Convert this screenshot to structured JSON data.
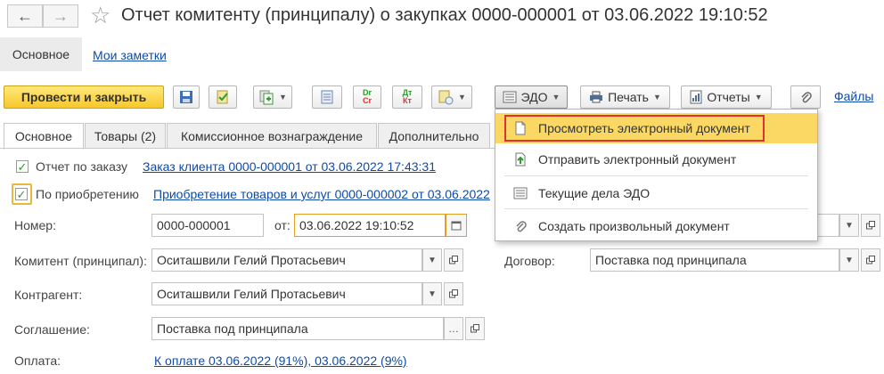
{
  "window": {
    "title": "Отчет комитенту (принципалу) о закупках 0000-000001 от 03.06.2022 19:10:52",
    "back_glyph": "←",
    "forward_glyph": "→",
    "star_glyph": "☆"
  },
  "subtabs": {
    "main": "Основное",
    "notes": "Мои заметки"
  },
  "toolbar": {
    "post_close": "Провести и закрыть",
    "edo": "ЭДО",
    "print": "Печать",
    "reports": "Отчеты",
    "files": "Файлы",
    "dtkt": {
      "top": "Дт",
      "bottom": "Кт"
    },
    "drcr": {
      "top": "Dr",
      "bottom": "Cr"
    }
  },
  "tabs": [
    "Основное",
    "Товары (2)",
    "Комиссионное вознаграждение",
    "Дополнительно"
  ],
  "form": {
    "order_report_label": "Отчет по заказу",
    "order_report_link": "Заказ клиента 0000-000001 от 03.06.2022 17:43:31",
    "purchase_label": "По приобретению",
    "purchase_link": "Приобретение товаров и услуг 0000-000002 от 03.06.2022",
    "number_label": "Номер:",
    "number_value": "0000-000001",
    "date_label": "от:",
    "date_value": "03.06.2022 19:10:52",
    "principal_label": "Комитент (принципал):",
    "principal_value": "Оситашвили Гелий Протасьевич",
    "contract_label": "Договор:",
    "contract_value": "Поставка под принципала",
    "counterparty_label": "Контрагент:",
    "counterparty_value": "Оситашвили Гелий Протасьевич",
    "agreement_label": "Соглашение:",
    "agreement_value": "Поставка под принципала",
    "payment_label": "Оплата:",
    "payment_link": "К оплате 03.06.2022 (91%), 03.06.2022 (9%)"
  },
  "edo_menu": {
    "items": [
      {
        "label": "Просмотреть электронный документ",
        "icon": "document-icon",
        "highlighted": true
      },
      {
        "label": "Отправить электронный документ",
        "icon": "send-document-icon"
      },
      {
        "label": "Текущие дела ЭДО",
        "icon": "tasks-icon"
      },
      {
        "label": "Создать произвольный документ",
        "icon": "paperclip-icon"
      }
    ]
  },
  "colors": {
    "primary_button": "#f7c72c",
    "menu_highlight": "#fbd864",
    "focus_border": "#e03030",
    "link": "#0e4ba8",
    "check": "#2f9a2f"
  }
}
